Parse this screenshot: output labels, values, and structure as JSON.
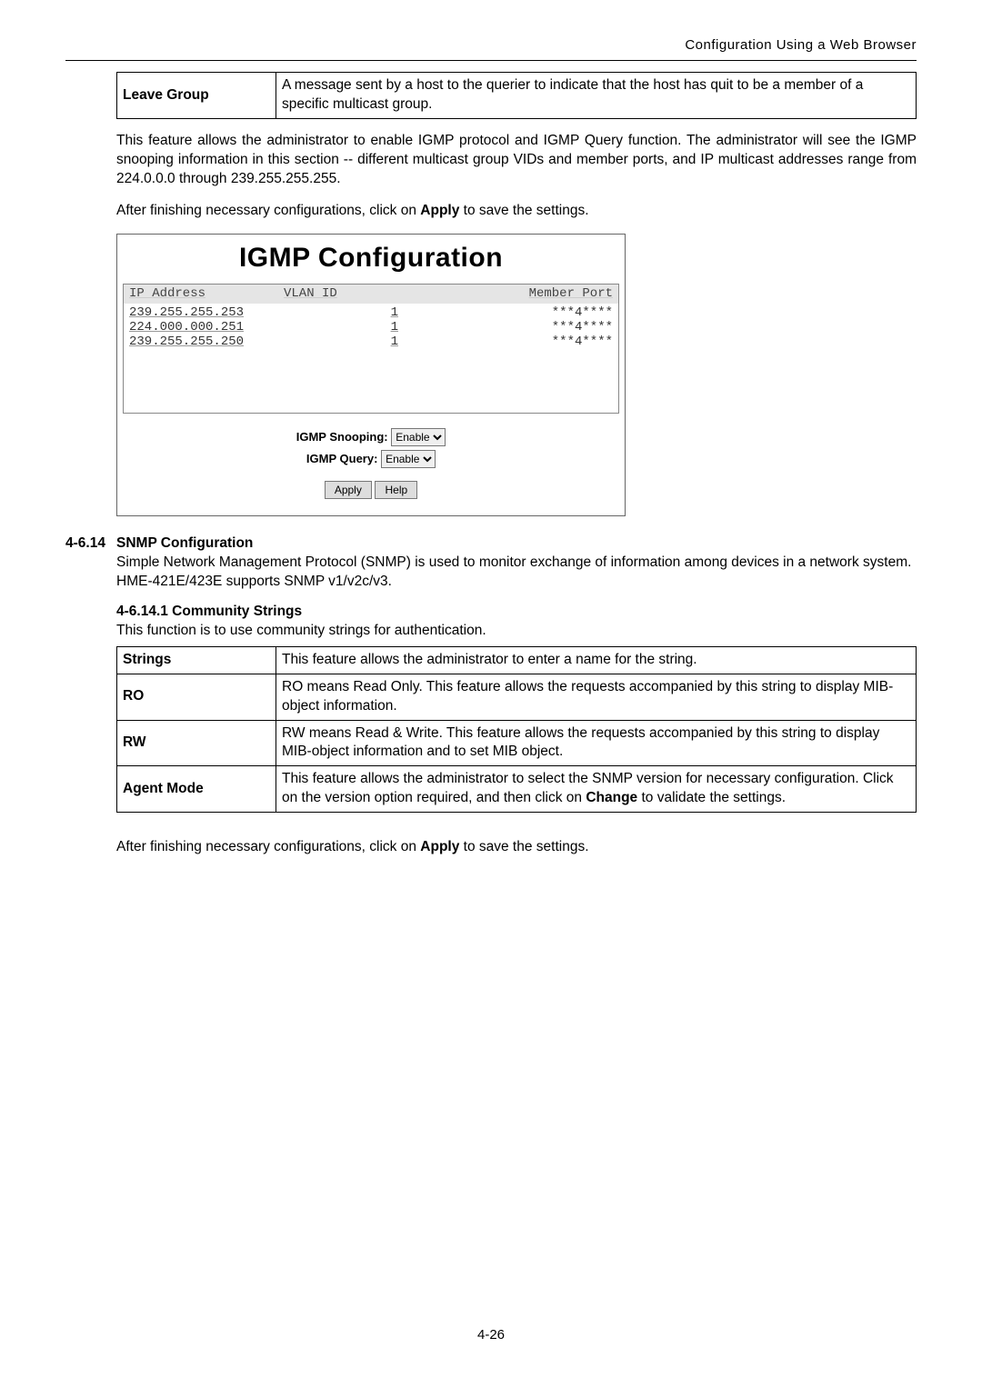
{
  "header": {
    "running_head": "Configuration Using a Web Browser"
  },
  "leave_group": {
    "label": "Leave Group",
    "desc": "A message sent by a host to the querier to indicate that the host has quit to be a member of a specific multicast group."
  },
  "intro": {
    "p1": "This feature allows the administrator to enable IGMP protocol and IGMP Query function. The administrator will see the IGMP snooping information in this section -- different multicast group VIDs and member ports, and IP multicast addresses range from 224.0.0.0 through 239.255.255.255.",
    "p2_a": "After finishing necessary configurations, click on ",
    "p2_bold": "Apply",
    "p2_b": " to save the settings."
  },
  "igmp_panel": {
    "title": "IGMP Configuration",
    "columns": {
      "ip": "IP Address",
      "vlan": "VLAN ID",
      "port": "Member Port"
    },
    "rows": [
      {
        "ip": "239.255.255.253",
        "vlan": "1",
        "port": "***4****"
      },
      {
        "ip": "224.000.000.251",
        "vlan": "1",
        "port": "***4****"
      },
      {
        "ip": "239.255.255.250",
        "vlan": "1",
        "port": "***4****"
      }
    ],
    "snooping_label": "IGMP Snooping:",
    "snooping_value": "Enable",
    "query_label": "IGMP Query:",
    "query_value": "Enable",
    "apply_btn": "Apply",
    "help_btn": "Help"
  },
  "snmp_section": {
    "num": "4-6.14",
    "title": "SNMP Configuration",
    "para": "Simple Network Management Protocol (SNMP) is used to monitor exchange of information among devices in a network system. HME-421E/423E supports SNMP v1/v2c/v3."
  },
  "community": {
    "num_title": "4-6.14.1  Community Strings",
    "intro": "This function is to use community strings for authentication.",
    "rows": {
      "strings": {
        "label": "Strings",
        "desc": "This feature allows the administrator to enter a name for the string."
      },
      "ro": {
        "label": "RO",
        "desc": "RO means Read Only. This feature allows the requests accompanied by this string to display MIB-object information."
      },
      "rw": {
        "label": "RW",
        "desc": "RW means Read & Write. This feature allows the requests accompanied by this string to display MIB-object information and to set MIB object."
      },
      "agent": {
        "label": "Agent Mode",
        "desc_a": "This feature allows the administrator to select the SNMP version for necessary configuration. Click on the version option required, and then click on ",
        "desc_bold": "Change",
        "desc_b": " to validate the settings."
      }
    }
  },
  "closing": {
    "a": "After finishing necessary configurations, click on ",
    "bold": "Apply",
    "b": " to save the settings."
  },
  "page_number": "4-26"
}
